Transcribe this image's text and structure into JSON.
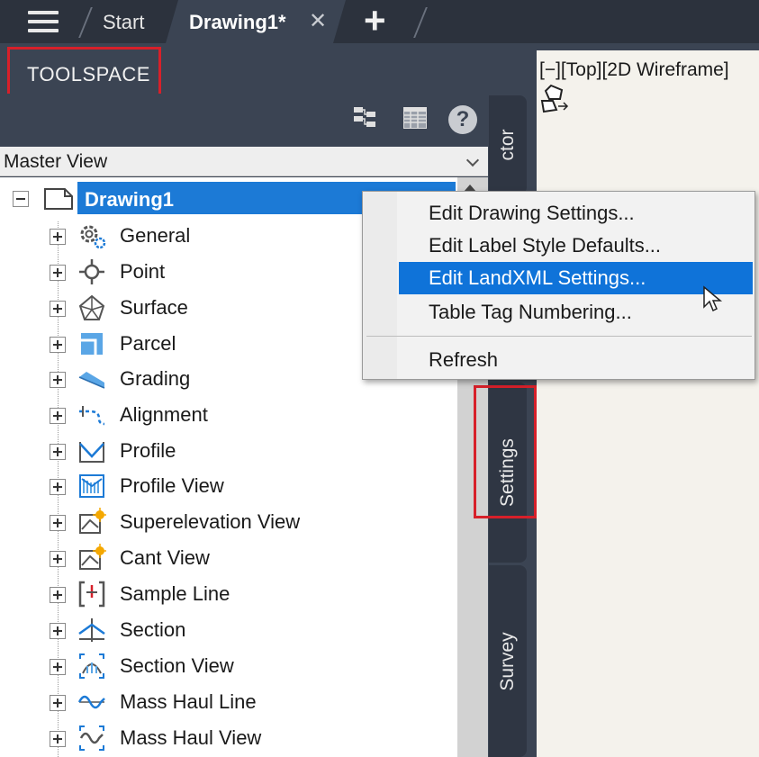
{
  "tabbar": {
    "start_tab": "Start",
    "active_tab": "Drawing1*",
    "close_glyph": "✕",
    "add_glyph": "+",
    "menu_icon": "hamburger-menu-icon"
  },
  "toolspace": {
    "title": "TOOLSPACE",
    "toolbar": {
      "icons": [
        "hierarchy-tree-icon",
        "table-list-icon",
        "help-icon"
      ],
      "help_glyph": "?"
    },
    "view_select": {
      "selected": "Master View"
    },
    "tree": {
      "root_label": "Drawing1",
      "items": [
        {
          "label": "General",
          "icon": "gear-icon"
        },
        {
          "label": "Point",
          "icon": "point-icon"
        },
        {
          "label": "Surface",
          "icon": "surface-icon"
        },
        {
          "label": "Parcel",
          "icon": "parcel-icon"
        },
        {
          "label": "Grading",
          "icon": "grading-icon"
        },
        {
          "label": "Alignment",
          "icon": "alignment-icon"
        },
        {
          "label": "Profile",
          "icon": "profile-icon"
        },
        {
          "label": "Profile View",
          "icon": "profile-view-icon"
        },
        {
          "label": "Superelevation View",
          "icon": "superelevation-view-icon"
        },
        {
          "label": "Cant View",
          "icon": "cant-view-icon"
        },
        {
          "label": "Sample Line",
          "icon": "sample-line-icon"
        },
        {
          "label": "Section",
          "icon": "section-icon"
        },
        {
          "label": "Section View",
          "icon": "section-view-icon"
        },
        {
          "label": "Mass Haul Line",
          "icon": "mass-haul-line-icon"
        },
        {
          "label": "Mass Haul View",
          "icon": "mass-haul-view-icon"
        }
      ]
    },
    "side_tabs": {
      "prospector": "ctor",
      "settings": "Settings",
      "survey": "Survey"
    }
  },
  "viewport": {
    "label": "[−][Top][2D Wireframe]"
  },
  "context_menu": {
    "items": [
      {
        "label": "Edit Drawing Settings..."
      },
      {
        "label": "Edit Label Style Defaults..."
      },
      {
        "label": "Edit LandXML Settings...",
        "selected": true
      },
      {
        "label": "Table Tag Numbering..."
      },
      {
        "label": "Refresh"
      }
    ]
  },
  "colors": {
    "highlight_red": "#d7202a",
    "selection_blue": "#1c7ad6",
    "panel_dark": "#3b4453"
  }
}
